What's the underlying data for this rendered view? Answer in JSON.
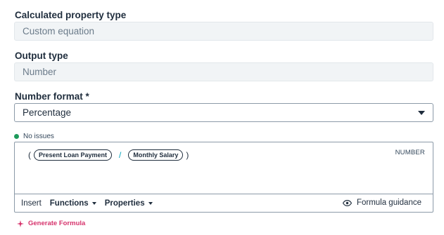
{
  "property_type": {
    "label": "Calculated property type",
    "value": "Custom equation"
  },
  "output_type": {
    "label": "Output type",
    "value": "Number"
  },
  "number_format": {
    "label": "Number format *",
    "value": "Percentage"
  },
  "status": {
    "text": "No issues",
    "color": "#1d9a5b"
  },
  "formula": {
    "open_paren": "(",
    "token1": "Present Loan Payment",
    "operator": "/",
    "token2": "Monthly Salary",
    "close_paren": ")",
    "result_type": "NUMBER"
  },
  "toolbar": {
    "insert_label": "Insert",
    "functions_label": "Functions",
    "properties_label": "Properties",
    "guidance_label": "Formula guidance"
  },
  "generate_label": "Generate Formula",
  "colors": {
    "accent_pink": "#d6336c",
    "operator": "#00a4bd"
  }
}
